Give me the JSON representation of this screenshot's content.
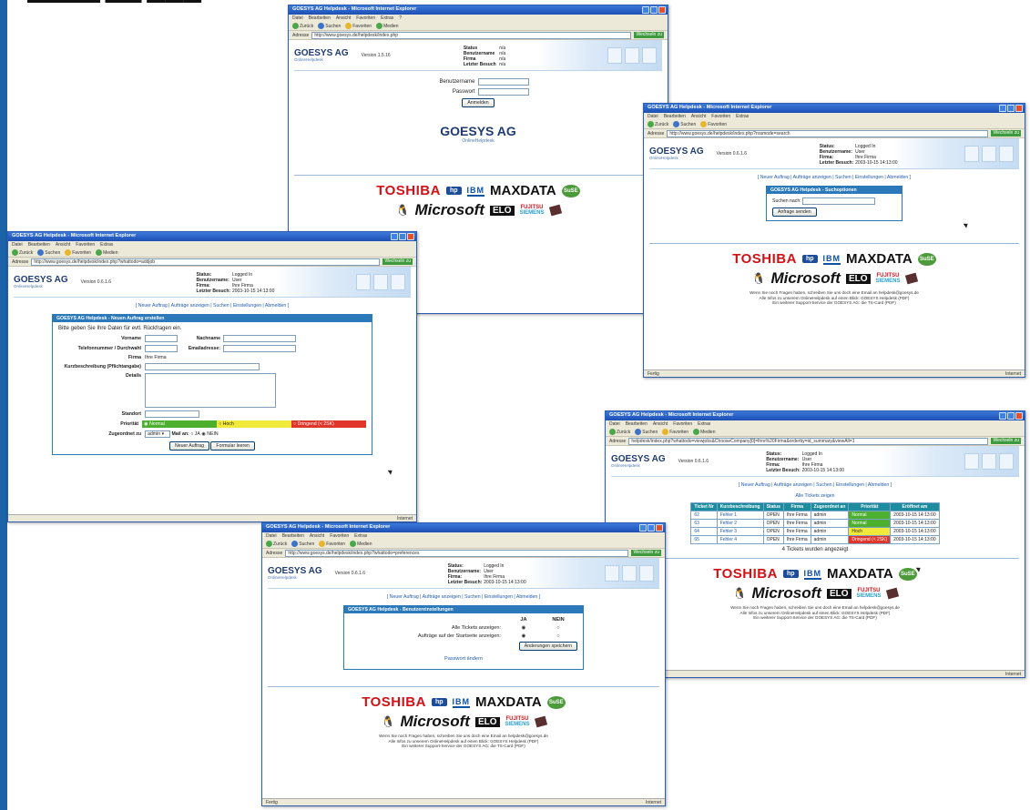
{
  "sponsors": {
    "toshiba": "TOSHIBA",
    "ibm": "IBM",
    "maxdata": "MAXDATA",
    "suse": "SuSE",
    "microsoft": "Microsoft",
    "elo": "ELO",
    "fujitsu": "FUJITSU",
    "siemens": "SIEMENS",
    "foot1": "Wenn Sie noch Fragen haben, schreiben Sie uns doch eine Email an helpdesk@goesys.de",
    "foot2": "Alle Infos zu unserem OnlineHelpdesk auf einen Blick: GOESYS Helpdesk (PDF)",
    "foot3": "Ein weiterer Support-Service der GOESYS AG: die TS-Card (PDF)"
  },
  "brand": {
    "logo": "GOESYS AG",
    "logo_sub": "OnlineHelpdesk"
  },
  "colors": {
    "accent": "#2b79ba",
    "titlebar": "#1c4fb5",
    "toshiba": "#d01217",
    "normal": "#4cb02e",
    "hoch": "#f2ea3b",
    "dringend": "#e0352b"
  },
  "windows": {
    "login": {
      "title": "GOESYS AG Helpdesk - Microsoft Internet Explorer",
      "menu": [
        "Datei",
        "Bearbeiten",
        "Ansicht",
        "Favoriten",
        "Extras",
        "?"
      ],
      "tools": [
        "Zurück",
        "Suchen",
        "Favoriten",
        "Medien"
      ],
      "address_label": "Adresse",
      "url": "http://www.goesys.de/helpdesk/index.php",
      "go": "Wechseln zu",
      "version": "Version 1.5.16",
      "status_lines": [
        [
          "Status",
          "n/a"
        ],
        [
          "Benutzername",
          "n/a"
        ],
        [
          "Firma",
          "n/a"
        ],
        [
          "Letzter Besuch",
          "n/a"
        ]
      ],
      "user_label": "Benutzername",
      "pass_label": "Passwort",
      "login_button": "Anmelden"
    },
    "search": {
      "title": "GOESYS AG Helpdesk - Microsoft Internet Explorer",
      "url": "http://www.goesys.de/helpdesk/index.php?nramode=search",
      "version": "Version 0.6.1.6",
      "status_lines": [
        [
          "Status:",
          "Logged In"
        ],
        [
          "Benutzername:",
          "User"
        ],
        [
          "Firma:",
          "Ihre Firma"
        ],
        [
          "Letzter Besuch:",
          "2003-10-15 14:13:00"
        ]
      ],
      "nav": "[ Neuer Auftrag | Aufträge anzeigen | Suchen | Einstellungen | Abmelden ]",
      "card_title": "GOESYS AG Helpdesk - Suchoptionen",
      "search_label": "Suchen nach:",
      "send_button": "Anfrage senden",
      "status_left": "Fertig",
      "status_right": "Internet"
    },
    "form": {
      "title": "GOESYS AG Helpdesk - Microsoft Internet Explorer",
      "url": "http://www.goesys.de/helpdesk/index.php?whattodo=addjob",
      "version": "Version 0.6.1.6",
      "status_lines": [
        [
          "Status:",
          "Logged In"
        ],
        [
          "Benutzername:",
          "User"
        ],
        [
          "Firma:",
          "Ihre Firma"
        ],
        [
          "Letzter Besuch:",
          "2003-10-15 14:13:00"
        ]
      ],
      "nav": "[ Neuer Auftrag | Aufträge anzeigen | Suchen | Einstellungen | Abmelden ]",
      "card_title": "GOESYS AG Helpdesk - Neuen Auftrag erstellen",
      "intro": "Bitte geben Sie Ihre Daten für evtl. Rückfragen ein.",
      "vorname": "Vorname",
      "nachname": "Nachname",
      "telefon": "Telefonnummer / Durchwahl",
      "email": "Emailadresse:",
      "firma": "Firma",
      "firma_value": "Ihre Firma",
      "kurz": "Kurzbeschreibung (Pflichtangabe)",
      "details": "Details",
      "standort": "Standort",
      "prio": "Priorität",
      "prio_normal": "Normal",
      "prio_hoch": "Hoch",
      "prio_dringend": "Dringend (< 2SK)",
      "zugeordnet": "Zugeordnet zu",
      "zugeordnet_value": "admin",
      "mail": "Mail an:",
      "ja": "JA",
      "nein": "NEIN",
      "neu_button": "Neuer Auftrag",
      "reset_button": "Formular leeren",
      "status_right": "Internet"
    },
    "tickets": {
      "title": "GOESYS AG Helpdesk - Microsoft Internet Explorer",
      "url": "helpdesk/index.php?whattodo=viewjobs&ChooseCompany[0]=Ihre%20Firma&orderby=id_summary&viewAll=1",
      "version": "Version 0.6.1.6",
      "status_lines": [
        [
          "Status:",
          "Logged In"
        ],
        [
          "Benutzername:",
          "User"
        ],
        [
          "Firma:",
          "Ihre Firma"
        ],
        [
          "Letzter Besuch:",
          "2003-10-15 14:13:00"
        ]
      ],
      "nav": "[ Neuer Auftrag | Aufträge anzeigen | Suchen | Einstellungen | Abmelden ]",
      "show_all": "Alle Tickets zeigen",
      "columns": [
        "Ticket Nr",
        "Kurzbeschreibung",
        "Status",
        "Firma",
        "Zugeordnet an",
        "Priorität",
        "Eröffnet am"
      ],
      "rows": [
        [
          "62",
          "Fehler 1",
          "OPEN",
          "Ihre Firma",
          "admin",
          "Normal",
          "2003-10-15 14:13:00"
        ],
        [
          "63",
          "Fehler 2",
          "OPEN",
          "Ihre Firma",
          "admin",
          "Normal",
          "2003-10-15 14:13:00"
        ],
        [
          "64",
          "Fehler 3",
          "OPEN",
          "Ihre Firma",
          "admin",
          "Hoch",
          "2003-10-15 14:13:00"
        ],
        [
          "65",
          "Fehler 4",
          "OPEN",
          "Ihre Firma",
          "admin",
          "Dringend (< 2SK)",
          "2003-10-15 14:13:00"
        ]
      ],
      "count": "4 Tickets wurden angezeigt",
      "status_right": "Internet"
    },
    "settings": {
      "title": "GOESYS AG Helpdesk - Microsoft Internet Explorer",
      "url": "http://www.goesys.de/helpdesk/index.php?whattodo=preferences",
      "version": "Version 0.6.1.6",
      "status_lines": [
        [
          "Status:",
          "Logged In"
        ],
        [
          "Benutzername:",
          "User"
        ],
        [
          "Firma:",
          "Ihre Firma"
        ],
        [
          "Letzter Besuch:",
          "2003-10-15 14:13:00"
        ]
      ],
      "nav": "[ Neuer Auftrag | Aufträge anzeigen | Suchen | Einstellungen | Abmelden ]",
      "card_title": "GOESYS AG Helpdesk - Benutzereinstellungen",
      "ja": "JA",
      "nein": "NEIN",
      "opt1": "Alle Tickets anzeigen:",
      "opt2": "Aufträge auf der Startseite anzeigen:",
      "save_button": "Änderungen speichern",
      "pw_link": "Passwort ändern",
      "status_left": "Fertig",
      "status_right": "Internet"
    }
  }
}
